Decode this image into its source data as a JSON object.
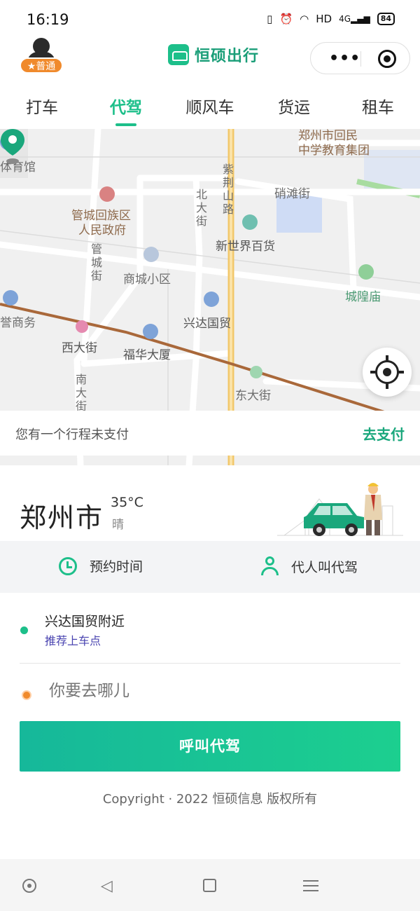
{
  "status_bar": {
    "time": "16:19",
    "network": "HD",
    "signal": "4G",
    "battery": "84"
  },
  "header": {
    "badge": "★普通",
    "brand_name": "恒硕出行",
    "more_icon": "•••",
    "icons": [
      "avatar-icon",
      "car-logo-icon",
      "more-icon",
      "target-icon"
    ]
  },
  "tabs": [
    {
      "label": "打车",
      "active": false
    },
    {
      "label": "代驾",
      "active": true
    },
    {
      "label": "顺风车",
      "active": false
    },
    {
      "label": "货运",
      "active": false
    },
    {
      "label": "租车",
      "active": false
    }
  ],
  "map": {
    "labels": {
      "school": "郑州市回民中学教育集团",
      "school_l1": "郑州市回民",
      "school_l2": "中学教育集团",
      "gym": "体育馆",
      "gov_l1": "管城回族区",
      "gov_l2": "人民政府",
      "xiaotan": "硝滩街",
      "zijing_road": "紫荆山路",
      "beida_street": "北大街",
      "guancheng_street": "管城街",
      "xinshijie": "新世界百货",
      "shangcheng": "商城小区",
      "chenghuangmiao": "城隍庙",
      "shangwu": "誉商务",
      "xingda": "兴达国贸",
      "xidajie": "西大街",
      "fuhua": "福华大厦",
      "nandajie": "南大街",
      "dongdajie": "东大街"
    }
  },
  "unpaid": {
    "message": "您有一个行程未支付",
    "action": "去支付"
  },
  "weather": {
    "city": "郑州市",
    "temperature": "35°C",
    "condition": "晴"
  },
  "options": {
    "schedule": "预约时间",
    "proxy": "代人叫代驾"
  },
  "pickup": {
    "address": "兴达国贸附近",
    "hint": "推荐上车点"
  },
  "destination": {
    "placeholder": "你要去哪儿"
  },
  "call_button": "呼叫代驾",
  "copyright": "Copyright · 2022 恒硕信息 版权所有",
  "colors": {
    "accent": "#1dbf8a",
    "pay": "#1aa77c",
    "badge": "#f08a2c",
    "hint": "#4a44b0"
  }
}
